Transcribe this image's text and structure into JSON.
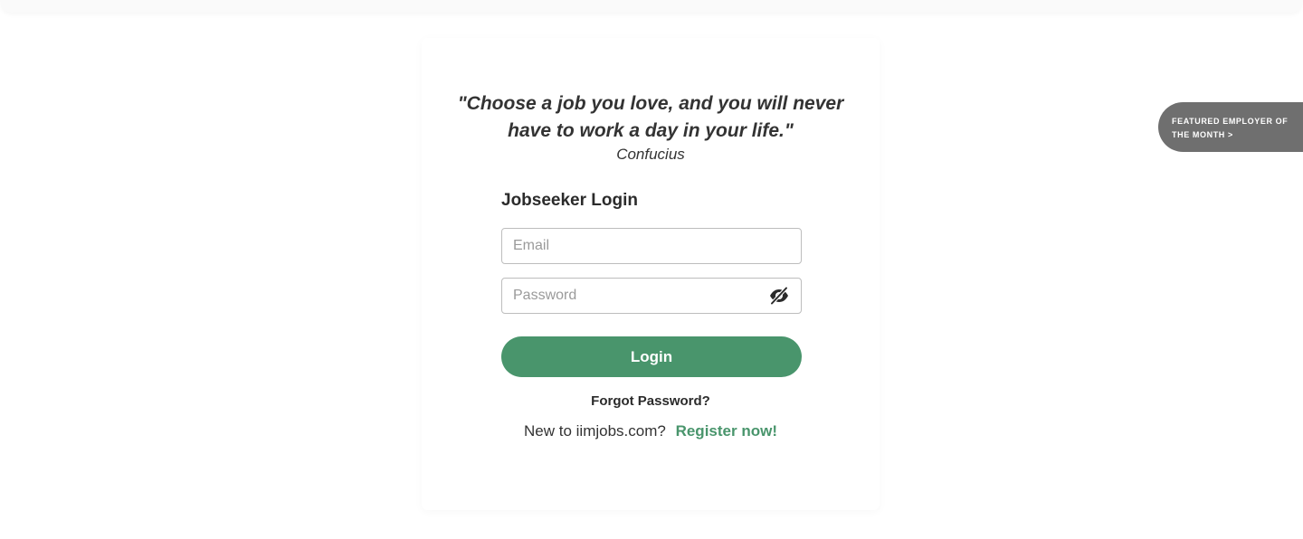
{
  "quote": {
    "text": "\"Choose a job you love, and you will never have to work a day in your life.\"",
    "author": "Confucius"
  },
  "login": {
    "title": "Jobseeker Login",
    "email_placeholder": "Email",
    "password_placeholder": "Password",
    "password_toggle_icon": "eye-slash-icon",
    "button_label": "Login",
    "forgot_label": "Forgot Password?",
    "register_prompt": "New to iimjobs.com?",
    "register_label": "Register now!"
  },
  "featured": {
    "label": "FEATURED EMPLOYER OF THE MONTH >"
  },
  "colors": {
    "accent": "#49956c",
    "featured_bg": "#6f6f6f",
    "text": "#2b2b2b"
  }
}
